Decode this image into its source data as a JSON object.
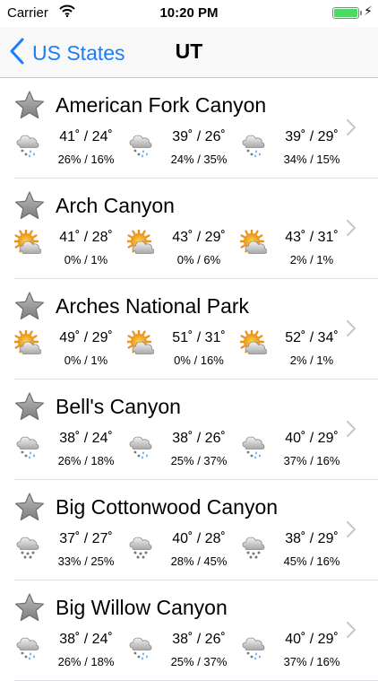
{
  "status": {
    "carrier": "Carrier",
    "time": "10:20 PM"
  },
  "nav": {
    "back_label": "US States",
    "title": "UT"
  },
  "colors": {
    "accent": "#1a7efb",
    "battery": "#4cd964",
    "star": "#9a9a9a",
    "sun": "#f5a623"
  },
  "rows": [
    {
      "name": "American Fork Canyon",
      "days": [
        {
          "icon": "snow-rain-icon",
          "temp": "41˚ / 24˚",
          "precip": "26% / 16%"
        },
        {
          "icon": "snow-rain-icon",
          "temp": "39˚ / 26˚",
          "precip": "24% / 35%"
        },
        {
          "icon": "snow-rain-icon",
          "temp": "39˚ / 29˚",
          "precip": "34% / 15%"
        }
      ]
    },
    {
      "name": "Arch Canyon",
      "days": [
        {
          "icon": "partly-sunny-icon",
          "temp": "41˚ / 28˚",
          "precip": "0% / 1%"
        },
        {
          "icon": "partly-sunny-icon",
          "temp": "43˚ / 29˚",
          "precip": "0% / 6%"
        },
        {
          "icon": "partly-sunny-icon",
          "temp": "43˚ / 31˚",
          "precip": "2% / 1%"
        }
      ]
    },
    {
      "name": "Arches National Park",
      "days": [
        {
          "icon": "partly-sunny-icon",
          "temp": "49˚ / 29˚",
          "precip": "0% / 1%"
        },
        {
          "icon": "partly-sunny-icon",
          "temp": "51˚ / 31˚",
          "precip": "0% / 16%"
        },
        {
          "icon": "partly-sunny-icon",
          "temp": "52˚ / 34˚",
          "precip": "2% / 1%"
        }
      ]
    },
    {
      "name": "Bell's Canyon",
      "days": [
        {
          "icon": "snow-rain-icon",
          "temp": "38˚ / 24˚",
          "precip": "26% / 18%"
        },
        {
          "icon": "snow-rain-icon",
          "temp": "38˚ / 26˚",
          "precip": "25% / 37%"
        },
        {
          "icon": "snow-rain-icon",
          "temp": "40˚ / 29˚",
          "precip": "37% / 16%"
        }
      ]
    },
    {
      "name": "Big Cottonwood Canyon",
      "days": [
        {
          "icon": "snow-icon",
          "temp": "37˚ / 27˚",
          "precip": "33% / 25%"
        },
        {
          "icon": "snow-icon",
          "temp": "40˚ / 28˚",
          "precip": "28% / 45%"
        },
        {
          "icon": "snow-icon",
          "temp": "38˚ / 29˚",
          "precip": "45% / 16%"
        }
      ]
    },
    {
      "name": "Big Willow Canyon",
      "days": [
        {
          "icon": "snow-rain-icon",
          "temp": "38˚ / 24˚",
          "precip": "26% / 18%"
        },
        {
          "icon": "snow-rain-icon",
          "temp": "38˚ / 26˚",
          "precip": "25% / 37%"
        },
        {
          "icon": "snow-rain-icon",
          "temp": "40˚ / 29˚",
          "precip": "37% / 16%"
        }
      ]
    }
  ]
}
